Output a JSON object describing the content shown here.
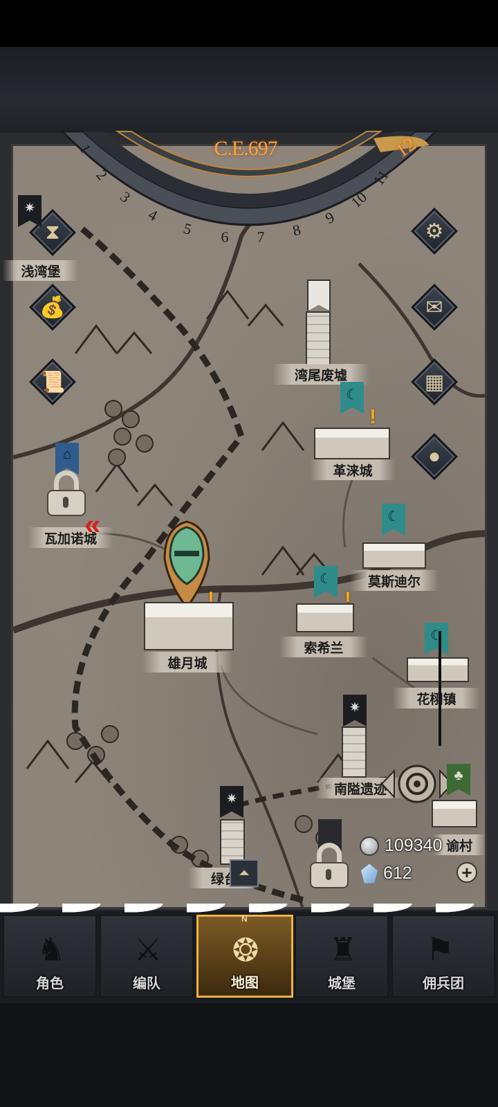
{
  "calendar": {
    "year": "C.E.697",
    "current_month": "12",
    "months": [
      "1",
      "2",
      "3",
      "4",
      "5",
      "6",
      "7",
      "8",
      "9",
      "10",
      "11"
    ]
  },
  "side_buttons_left": [
    {
      "name": "hourglass-icon"
    },
    {
      "name": "money-bag-icon"
    },
    {
      "name": "scroll-icon"
    }
  ],
  "side_buttons_right": [
    {
      "name": "settings-gear-icon"
    },
    {
      "name": "mail-icon"
    },
    {
      "name": "grid-icon"
    },
    {
      "name": "coin-icon"
    }
  ],
  "locations": {
    "qian_wan_bao": "浅湾堡",
    "wan_wei_fei_xu": "湾尾废墟",
    "ge_lai_cheng": "革涞城",
    "wa_jia_nuo_cheng": "瓦加诺城",
    "mo_si_di_er": "莫斯迪尔",
    "xiong_yue_cheng": "雄月城",
    "suo_xi_lan": "索希兰",
    "hua_xu_zhen": "花栩镇",
    "nan_yi_yi_ji": "南隘遗迹",
    "lv_tai": "绿台",
    "yu_cun": "谕村"
  },
  "currency": {
    "silver": "109340",
    "crystal": "612"
  },
  "nav": {
    "tabs": [
      {
        "label": "角色",
        "active": false
      },
      {
        "label": "编队",
        "active": false
      },
      {
        "label": "地图",
        "active": true
      },
      {
        "label": "城堡",
        "active": false
      },
      {
        "label": "佣兵团",
        "active": false
      }
    ],
    "compass_letter": "N"
  },
  "colors": {
    "accent": "#f2a34a",
    "faction_teal": "#2f8c8a",
    "alert": "#f5a623"
  }
}
